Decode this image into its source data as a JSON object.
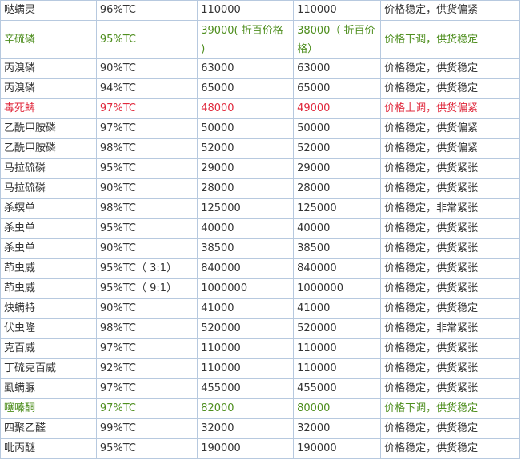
{
  "table": {
    "rows": [
      {
        "name": "哒螨灵",
        "spec": "96%TC",
        "price_prev": "110000",
        "price_now": "110000",
        "status": "价格稳定，供货偏紧",
        "tone": "normal"
      },
      {
        "name": "辛硫磷",
        "spec": "95%TC",
        "price_prev": "39000( 折百价格 )",
        "price_now": "38000（ 折百价格）",
        "status": "价格下调，供货稳定",
        "tone": "green"
      },
      {
        "name": "丙溴磷",
        "spec": "90%TC",
        "price_prev": "63000",
        "price_now": "63000",
        "status": "价格稳定，供货稳定",
        "tone": "normal"
      },
      {
        "name": "丙溴磷",
        "spec": "94%TC",
        "price_prev": "65000",
        "price_now": "65000",
        "status": "价格稳定，供货稳定",
        "tone": "normal"
      },
      {
        "name": "毒死蜱",
        "spec": "97%TC",
        "price_prev": "48000",
        "price_now": "49000",
        "status": "价格上调，供货偏紧",
        "tone": "red"
      },
      {
        "name": "乙酰甲胺磷",
        "spec": "97%TC",
        "price_prev": "50000",
        "price_now": "50000",
        "status": "价格稳定，供货偏紧",
        "tone": "normal"
      },
      {
        "name": "乙酰甲胺磷",
        "spec": "98%TC",
        "price_prev": "52000",
        "price_now": "52000",
        "status": "价格稳定，供货偏紧",
        "tone": "normal"
      },
      {
        "name": "马拉硫磷",
        "spec": "95%TC",
        "price_prev": "29000",
        "price_now": "29000",
        "status": "价格稳定，供货紧张",
        "tone": "normal"
      },
      {
        "name": "马拉硫磷",
        "spec": "90%TC",
        "price_prev": "28000",
        "price_now": "28000",
        "status": "价格稳定，供货紧张",
        "tone": "normal"
      },
      {
        "name": "杀螟单",
        "spec": "98%TC",
        "price_prev": "125000",
        "price_now": "125000",
        "status": "价格稳定，非常紧张",
        "tone": "normal"
      },
      {
        "name": "杀虫单",
        "spec": "95%TC",
        "price_prev": "40000",
        "price_now": "40000",
        "status": "价格稳定，供货紧张",
        "tone": "normal"
      },
      {
        "name": "杀虫单",
        "spec": "90%TC",
        "price_prev": "38500",
        "price_now": "38500",
        "status": "价格稳定，供货紧张",
        "tone": "normal"
      },
      {
        "name": "茚虫威",
        "spec": "95%TC（ 3:1）",
        "price_prev": "840000",
        "price_now": "840000",
        "status": "价格稳定，供货紧张",
        "tone": "normal"
      },
      {
        "name": "茚虫威",
        "spec": "95%TC（ 9:1）",
        "price_prev": "1000000",
        "price_now": "1000000",
        "status": "价格稳定，供货紧张",
        "tone": "normal"
      },
      {
        "name": "炔螨特",
        "spec": "90%TC",
        "price_prev": "41000",
        "price_now": "41000",
        "status": "价格稳定，供货稳定",
        "tone": "normal"
      },
      {
        "name": "伏虫隆",
        "spec": "98%TC",
        "price_prev": "520000",
        "price_now": "520000",
        "status": "价格稳定，非常紧张",
        "tone": "normal"
      },
      {
        "name": "克百威",
        "spec": "97%TC",
        "price_prev": "110000",
        "price_now": "110000",
        "status": "价格稳定，供货紧张",
        "tone": "normal"
      },
      {
        "name": "丁硫克百威",
        "spec": "92%TC",
        "price_prev": "110000",
        "price_now": "110000",
        "status": "价格稳定，供货紧张",
        "tone": "normal"
      },
      {
        "name": "虱螨脲",
        "spec": "97%TC",
        "price_prev": "455000",
        "price_now": "455000",
        "status": "价格稳定，供货紧张",
        "tone": "normal"
      },
      {
        "name": "噻嗪酮",
        "spec": "97%TC",
        "price_prev": "82000",
        "price_now": "80000",
        "status": "价格下调，供货稳定",
        "tone": "green"
      },
      {
        "name": "四聚乙醛",
        "spec": "99%TC",
        "price_prev": "32000",
        "price_now": "32000",
        "status": "价格稳定，供货稳定",
        "tone": "normal"
      },
      {
        "name": "吡丙醚",
        "spec": "95%TC",
        "price_prev": "190000",
        "price_now": "190000",
        "status": "价格稳定，供货稳定",
        "tone": "normal"
      }
    ]
  },
  "colors": {
    "text": "#333333",
    "border": "#b7c9df",
    "green": "#4e8e1e",
    "red": "#e0283c"
  }
}
